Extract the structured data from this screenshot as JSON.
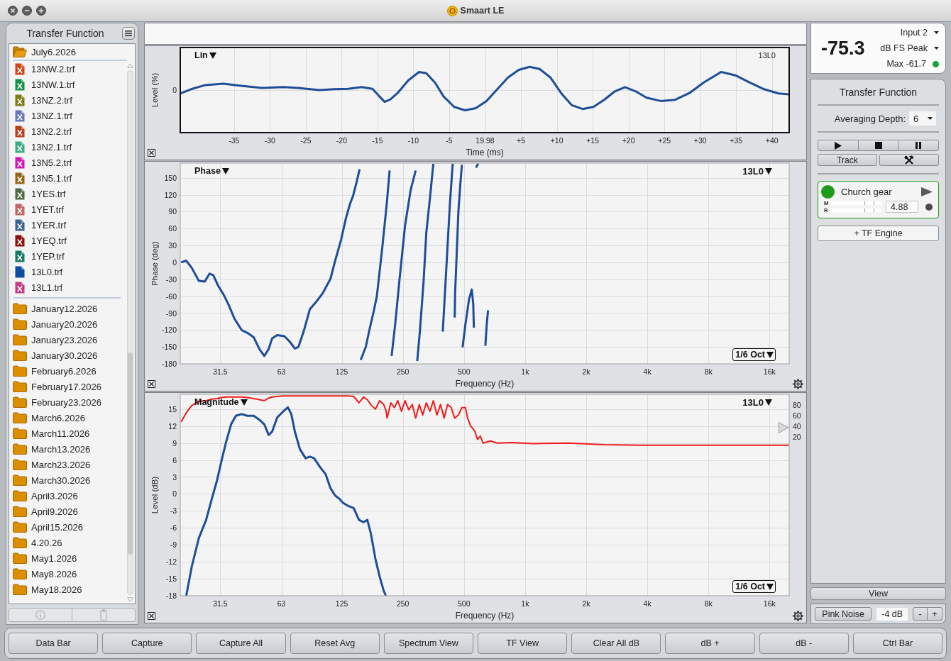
{
  "window": {
    "title": "Smaart LE"
  },
  "sidebar": {
    "title": "Transfer Function",
    "folders": [
      {
        "name": "July6.2026",
        "expanded": true,
        "children": [
          {
            "name": "13NW.2.trf",
            "color": "#d2461a",
            "shown": false
          },
          {
            "name": "13NW.1.trf",
            "color": "#14924a",
            "shown": false
          },
          {
            "name": "13NZ.2.trf",
            "color": "#7d7a14",
            "shown": false
          },
          {
            "name": "13NZ.1.trf",
            "color": "#6878b4",
            "shown": false
          },
          {
            "name": "13N2.2.trf",
            "color": "#b8401c",
            "shown": false
          },
          {
            "name": "13N2.1.trf",
            "color": "#3aaa86",
            "shown": false
          },
          {
            "name": "13N5.2.trf",
            "color": "#d018b4",
            "shown": false
          },
          {
            "name": "13N5.1.trf",
            "color": "#946614",
            "shown": false
          },
          {
            "name": "1YES.trf",
            "color": "#4a6a44",
            "shown": false
          },
          {
            "name": "1YET.trf",
            "color": "#c06464",
            "shown": false
          },
          {
            "name": "1YER.trf",
            "color": "#3a6490",
            "shown": false
          },
          {
            "name": "1YEQ.trf",
            "color": "#8c1010",
            "shown": false
          },
          {
            "name": "1YEP.trf",
            "color": "#147a64",
            "shown": false
          },
          {
            "name": "13L0.trf",
            "color": "#0c4ca0",
            "shown": true
          },
          {
            "name": "13L1.trf",
            "color": "#c23e84",
            "shown": false
          }
        ]
      },
      {
        "name": "January12.2026",
        "expanded": false
      },
      {
        "name": "January20.2026",
        "expanded": false
      },
      {
        "name": "January23.2026",
        "expanded": false
      },
      {
        "name": "January30.2026",
        "expanded": false
      },
      {
        "name": "February6.2026",
        "expanded": false
      },
      {
        "name": "February17.2026",
        "expanded": false
      },
      {
        "name": "February23.2026",
        "expanded": false
      },
      {
        "name": "March6.2026",
        "expanded": false
      },
      {
        "name": "March11.2026",
        "expanded": false
      },
      {
        "name": "March13.2026",
        "expanded": false
      },
      {
        "name": "March23.2026",
        "expanded": false
      },
      {
        "name": "March30.2026",
        "expanded": false
      },
      {
        "name": "April3.2026",
        "expanded": false
      },
      {
        "name": "April9.2026",
        "expanded": false
      },
      {
        "name": "April15.2026",
        "expanded": false
      },
      {
        "name": "4.20.26",
        "expanded": false
      },
      {
        "name": "May1.2026",
        "expanded": false
      },
      {
        "name": "May8.2026",
        "expanded": false
      },
      {
        "name": "May18.2026",
        "expanded": false
      }
    ]
  },
  "plots": [
    {
      "kind": "time",
      "mode_label": "Lin",
      "trace_label": "13L0",
      "xlabel": "Time (ms)",
      "ylabel": "Level (%)",
      "x_tick_labels": [
        "-35",
        "-30",
        "-25",
        "-20",
        "-15",
        "-10",
        "-5",
        "19.98",
        "+5",
        "+10",
        "+15",
        "+20",
        "+25",
        "+30",
        "+35",
        "+40"
      ],
      "y_tick_labels": [
        "0"
      ]
    },
    {
      "kind": "phase",
      "mode_label": "Phase",
      "trace_label": "13L0",
      "smoothing": "1/6 Oct",
      "chart_data": {
        "type": "line",
        "xlabel": "Frequency (Hz)",
        "ylabel": "Phase (deg)",
        "grid": true,
        "log": "x",
        "xlim": [
          20,
          20000
        ],
        "ylim": [
          -180,
          176
        ],
        "xticks": [
          31.5,
          63,
          125,
          250,
          500,
          {
            "value": 1000,
            "label": "1k"
          },
          {
            "value": 2000,
            "label": "2k"
          },
          {
            "value": 4000,
            "label": "4k"
          },
          {
            "value": 8000,
            "label": "8k"
          },
          {
            "value": 16000,
            "label": "16k"
          }
        ],
        "yticks": [
          150,
          120,
          90,
          60,
          30,
          0,
          -30,
          -60,
          -90,
          -120,
          -150,
          -180
        ],
        "x": [
          20.2,
          21.4,
          22.8,
          24.7,
          26.4,
          27.9,
          29.1,
          30.7,
          32.8,
          34.7,
          37.0,
          40.1,
          42.8,
          46.0,
          49.1,
          51.9,
          54.5,
          56.7,
          60.0,
          65.1,
          69.4,
          73.4,
          76.4,
          81.5,
          87.0,
          93.5,
          101,
          110,
          116,
          124,
          131,
          137,
          142,
          148,
          153,
          155,
          164,
          171,
          180,
          186,
          198,
          208,
          215,
          220,
          229,
          240,
          256,
          273,
          289,
          294,
          303,
          316,
          326,
          340,
          353,
          393,
          409,
          426,
          440,
          450,
          452,
          469,
          480,
          488,
          492,
          508,
          529,
          546,
          555,
          559,
          573,
          587,
          637,
          647,
          657
        ],
        "series": [
          {
            "color": "#1d4e96",
            "values": [
              0,
              3,
              -10,
              -33,
              -34,
              -20,
              -23,
              -41,
              -58,
              -76,
              -100,
              -120,
              -125,
              -133,
              -154,
              -166,
              -154,
              -135,
              -129,
              -131,
              -141,
              -153,
              -150,
              -120,
              -83,
              -70,
              -54,
              -29,
              3,
              40,
              78,
              103,
              118,
              143,
              165,
              -173,
              -150,
              -120,
              -85,
              -60,
              28,
              103,
              163,
              -166,
              -110,
              -35,
              65,
              128,
              163,
              -175,
              -123,
              -35,
              53,
              115,
              175,
              -123,
              -10,
              103,
              175,
              -98,
              -54,
              90,
              140,
              173,
              -151,
              -110,
              -66,
              -48,
              -73,
              -116,
              168,
              175,
              -148,
              -110,
              -85
            ]
          }
        ]
      }
    },
    {
      "kind": "magnitude",
      "mode_label": "Magnitude",
      "trace_label": "13L0",
      "smoothing": "1/6 Oct",
      "chart_data": {
        "type": "line",
        "xlabel": "Frequency (Hz)",
        "ylabel": "Level (dB)",
        "grid": true,
        "log": "x",
        "xlim": [
          20,
          20000
        ],
        "ylim": [
          -18,
          17.6
        ],
        "y2lim": [
          -280,
          100
        ],
        "xticks": [
          31.5,
          63,
          125,
          250,
          500,
          {
            "value": 1000,
            "label": "1k"
          },
          {
            "value": 2000,
            "label": "2k"
          },
          {
            "value": 4000,
            "label": "4k"
          },
          {
            "value": 8000,
            "label": "8k"
          },
          {
            "value": 16000,
            "label": "16k"
          }
        ],
        "yticks": [
          15,
          12,
          9,
          6,
          3,
          0,
          -3,
          -6,
          -9,
          -12,
          -15,
          -18
        ],
        "y2ticks": [
          80,
          60,
          40,
          20
        ],
        "x": [
          20.2,
          21.4,
          22.8,
          24.7,
          26.8,
          28.6,
          30.3,
          32.0,
          33.6,
          35.6,
          37.6,
          40.1,
          42.8,
          46.0,
          49.1,
          51.9,
          54.5,
          56.7,
          60.0,
          64.0,
          67.7,
          70.5,
          73.4,
          77.7,
          82.9,
          87.0,
          91.3,
          97.4,
          104,
          110,
          116,
          122,
          126,
          134,
          143,
          152,
          160,
          167,
          174,
          183,
          192,
          201,
          206,
          209,
          218,
          227,
          236,
          246,
          256,
          267,
          278,
          289,
          301,
          313,
          326,
          340,
          353,
          368,
          383,
          399,
          415,
          432,
          450,
          469,
          488,
          508,
          521,
          538,
          564,
          583,
          602,
          621,
          674,
          730,
          858,
          1093,
          1635,
          2447,
          3660,
          8206,
          20000
        ],
        "series": [
          {
            "color": "#1d4e96",
            "values": [
              null,
              -18,
              -12.8,
              -7.8,
              -4.6,
              -0.9,
              2.3,
              6,
              9.1,
              12.3,
              13.8,
              14.1,
              13.8,
              13.8,
              13.1,
              12.3,
              10.4,
              11,
              13.5,
              14.5,
              15.3,
              14.1,
              11,
              7.9,
              6.3,
              6.6,
              6.3,
              4.8,
              3.5,
              1,
              -0.3,
              -0.9,
              -1.5,
              -2.1,
              -2.5,
              -4.6,
              -5,
              -4.6,
              -7.1,
              -11.5,
              -14.6,
              -17.1,
              -18,
              null,
              null,
              null,
              null,
              null,
              null,
              null,
              null,
              null,
              null,
              null,
              null,
              null,
              null,
              null,
              null,
              null,
              null,
              null,
              null,
              null,
              null,
              null,
              null,
              null,
              null,
              null,
              null,
              null,
              null,
              null,
              null,
              null,
              null,
              null,
              null,
              null,
              null
            ]
          },
          {
            "color": "#ee1c1c",
            "axis": "y2",
            "values": [
              48,
              65,
              79,
              87,
              88,
              91,
              92,
              94,
              95,
              95,
              95,
              95,
              94,
              92,
              90,
              88,
              93,
              95,
              96,
              97,
              97,
              97,
              97,
              97,
              97,
              97,
              97,
              97,
              97,
              97,
              97,
              97,
              97,
              97,
              96,
              84,
              95,
              90,
              80,
              72,
              88,
              81,
              70,
              55,
              84,
              75,
              88,
              68,
              88,
              71,
              81,
              55,
              81,
              61,
              84,
              68,
              88,
              61,
              81,
              55,
              81,
              75,
              55,
              61,
              75,
              75,
              55,
              41,
              31,
              15,
              21,
              8,
              12,
              8,
              9,
              7,
              8,
              5,
              4,
              4,
              4
            ]
          }
        ]
      }
    }
  ],
  "meter": {
    "reading": "-75.3",
    "input": "Input 2",
    "scale": "dB FS Peak",
    "max": "Max -61.7",
    "clipping": false
  },
  "tf_panel": {
    "title": "Transfer Function",
    "averaging_label": "Averaging Depth:",
    "averaging_value": "6",
    "track_button": "Track",
    "engines": [
      {
        "name": "Church gear",
        "color": "#1e9a1e",
        "delay": "4.88",
        "meters": [
          "M",
          "R"
        ]
      }
    ],
    "add_engine_button": "+ TF Engine"
  },
  "view_button": "View",
  "generator": {
    "button": "Pink Noise",
    "gain": "-4 dB",
    "steps": [
      "-",
      "+"
    ]
  },
  "command_bar": [
    "Data Bar",
    "Capture",
    "Capture All",
    "Reset Avg",
    "Spectrum View",
    "TF View",
    "Clear All dB",
    "dB +",
    "dB -",
    "Ctrl Bar"
  ]
}
